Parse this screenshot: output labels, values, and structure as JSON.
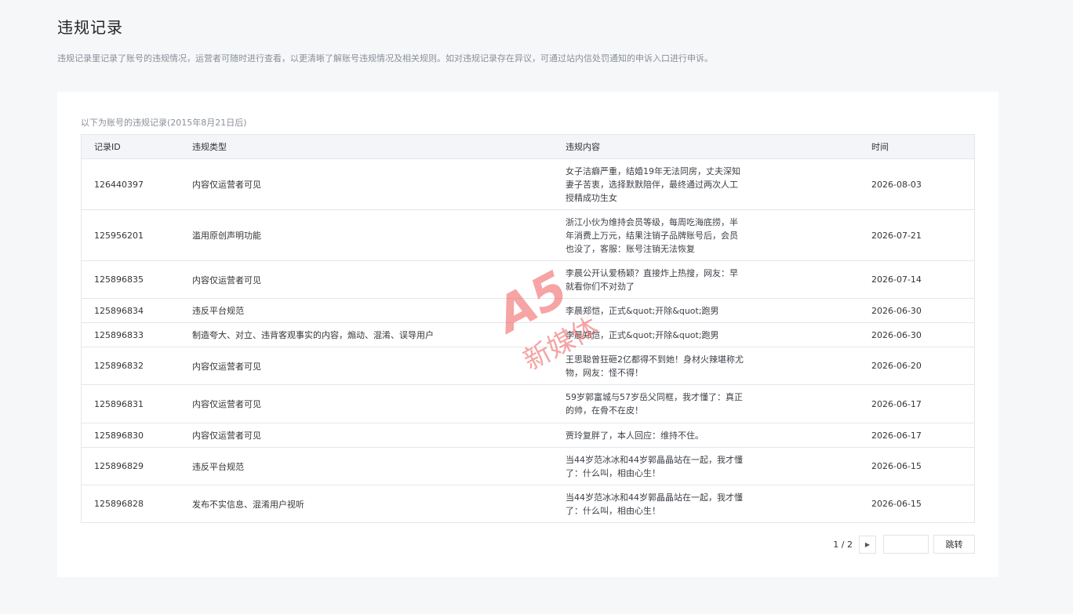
{
  "page": {
    "title": "违规记录",
    "description": "违规记录里记录了账号的违规情况，运营者可随时进行查看，以更清晰了解账号违规情况及相关规则。如对违规记录存在异议，可通过站内信处罚通知的申诉入口进行申诉。"
  },
  "table": {
    "caption": "以下为账号的违规记录(2015年8月21日后)",
    "headers": {
      "id": "记录ID",
      "type": "违规类型",
      "content": "违规内容",
      "time": "时间"
    },
    "rows": [
      {
        "id": "126440397",
        "type": "内容仅运营者可见",
        "content": "女子洁癖严重，结婚19年无法同房，丈夫深知妻子苦衷，选择默默陪伴，最终通过两次人工授精成功生女",
        "time": "2026-08-03"
      },
      {
        "id": "125956201",
        "type": "滥用原创声明功能",
        "content": "浙江小伙为维持会员等级，每周吃海底捞，半年消费上万元，结果注销子品牌账号后，会员也没了，客服：账号注销无法恢复",
        "time": "2026-07-21"
      },
      {
        "id": "125896835",
        "type": "内容仅运营者可见",
        "content": "李晨公开认爱杨颖？直接炸上热搜，网友：早就看你们不对劲了",
        "time": "2026-07-14"
      },
      {
        "id": "125896834",
        "type": "违反平台规范",
        "content": "李晨郑恺，正式&quot;开除&quot;跑男",
        "time": "2026-06-30"
      },
      {
        "id": "125896833",
        "type": "制造夸大、对立、违背客观事实的内容，煽动、混淆、误导用户",
        "content": "李晨郑恺，正式&quot;开除&quot;跑男",
        "time": "2026-06-30"
      },
      {
        "id": "125896832",
        "type": "内容仅运营者可见",
        "content": "王思聪曾狂砸2亿都得不到她！身材火辣堪称尤物，网友：怪不得！",
        "time": "2026-06-20"
      },
      {
        "id": "125896831",
        "type": "内容仅运营者可见",
        "content": "59岁郭富城与57岁岳父同框，我才懂了：真正的帅，在骨不在皮！",
        "time": "2026-06-17"
      },
      {
        "id": "125896830",
        "type": "内容仅运营者可见",
        "content": "贾玲复胖了，本人回应：维持不住。",
        "time": "2026-06-17"
      },
      {
        "id": "125896829",
        "type": "违反平台规范",
        "content": "当44岁范冰冰和44岁郭晶晶站在一起，我才懂了：什么叫，相由心生！",
        "time": "2026-06-15"
      },
      {
        "id": "125896828",
        "type": "发布不实信息、混淆用户视听",
        "content": "当44岁范冰冰和44岁郭晶晶站在一起，我才懂了：什么叫，相由心生！",
        "time": "2026-06-15"
      }
    ]
  },
  "pagination": {
    "page_info": "1 / 2",
    "next_icon": "chevron-right-icon",
    "jump_value": "",
    "jump_label": "跳转"
  },
  "watermark": {
    "logo_text": "A5",
    "text": "新媒体",
    "color": "#f05a5a"
  }
}
